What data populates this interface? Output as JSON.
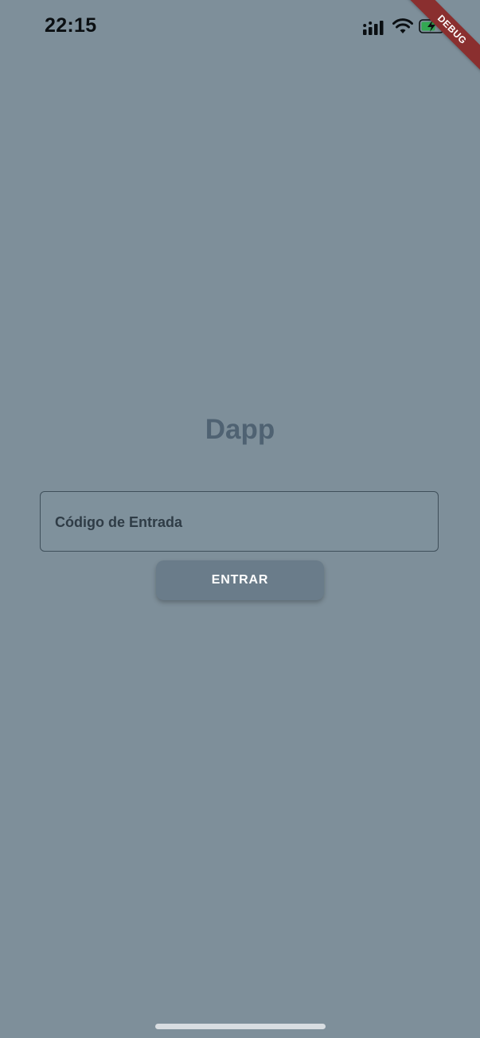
{
  "status_bar": {
    "time": "22:15",
    "icons": [
      "signal-icon",
      "wifi-icon",
      "battery-charging-icon"
    ]
  },
  "debug_banner": {
    "label": "DEBUG",
    "color": "#8a2f2f"
  },
  "app": {
    "title": "Dapp"
  },
  "login_form": {
    "code_input": {
      "placeholder": "Código de Entrada",
      "value": ""
    },
    "enter_button_label": "ENTRAR"
  },
  "colors": {
    "background": "#7e8f9a",
    "title": "#4f6272",
    "button": "#6a7c8a",
    "input_border": "#3f4f5a"
  }
}
